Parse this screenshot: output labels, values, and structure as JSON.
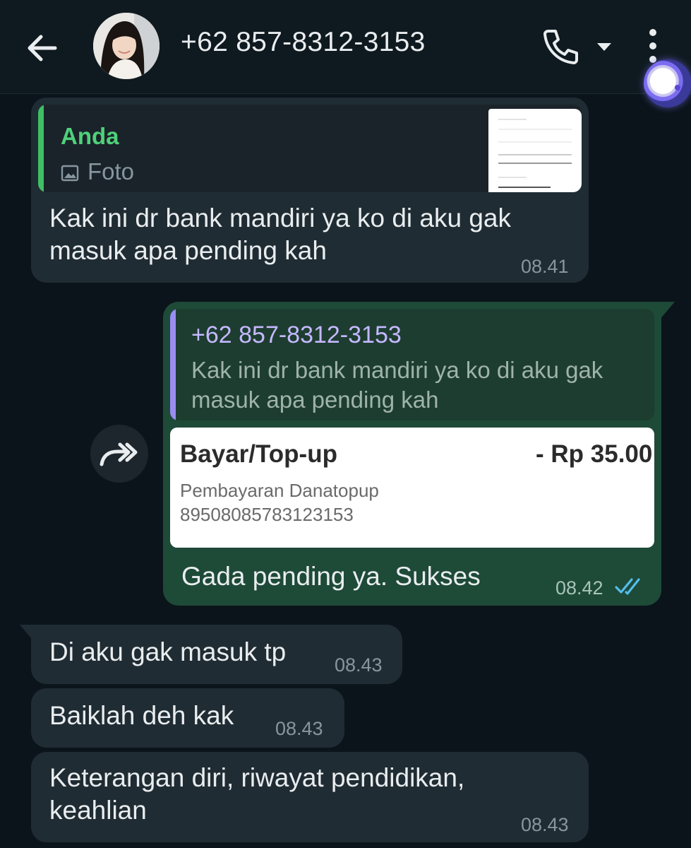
{
  "header": {
    "title": "+62 857-8312-3153"
  },
  "messages": [
    {
      "direction": "incoming",
      "reply": {
        "author": "Anda",
        "type_label": "Foto"
      },
      "text": "Kak ini dr bank mandiri ya ko di aku gak masuk apa pending kah",
      "text_line1": "Kak ini dr bank mandiri ya ko di aku gak",
      "text_line2": "masuk apa pending kah",
      "time": "08.41"
    },
    {
      "direction": "outgoing",
      "reply": {
        "author": "+62 857-8312-3153",
        "line1": "Kak ini dr bank mandiri ya ko di aku gak",
        "line2": "masuk apa pending kah"
      },
      "receipt": {
        "title": "Bayar/Top-up",
        "amount": "- Rp 35.00",
        "desc_line1": "Pembayaran Danatopup",
        "desc_line2": "89508085783123153"
      },
      "text": "Gada pending ya. Sukses",
      "time": "08.42",
      "status": "read-double-check"
    },
    {
      "direction": "incoming",
      "text": "Di aku gak masuk tp",
      "time": "08.43"
    },
    {
      "direction": "incoming",
      "text": "Baiklah deh kak",
      "time": "08.43"
    },
    {
      "direction": "incoming",
      "text_line1": "Keterangan diri, riwayat pendidikan,",
      "text_line2": "keahlian",
      "time": "08.43"
    }
  ],
  "colors": {
    "background": "#0b141a",
    "incoming_bubble": "#202c33",
    "outgoing_bubble": "#1e4a38",
    "reply_author_green": "#4fd07a",
    "reply_author_purple": "#c5b8ff",
    "read_ticks": "#53bdeb"
  },
  "icons": [
    "back-arrow-icon",
    "phone-icon",
    "chevron-down-icon",
    "more-vertical-icon",
    "photo-icon",
    "forward-icon",
    "double-check-icon",
    "assistant-icon"
  ]
}
